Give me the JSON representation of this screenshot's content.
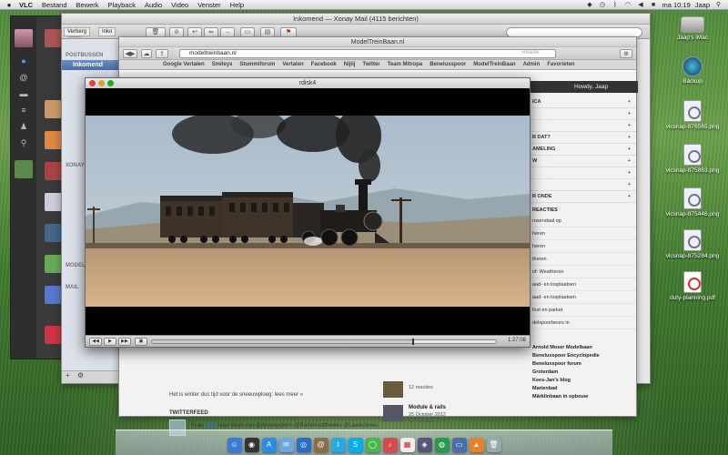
{
  "menubar": {
    "apple": "",
    "items": [
      "VLC",
      "Bestand",
      "Bewerk",
      "Playback",
      "Audio",
      "Video",
      "Venster",
      "Help"
    ],
    "clock": "ma 10:19",
    "user": "Jaap"
  },
  "mail": {
    "title": "Inkomend — Xonay Mail (4115 berichten)",
    "search_placeholder": "",
    "tab_hide": "Verberg",
    "tab_inbox": "Inko",
    "section_mailboxes": "POSTBUSSEN",
    "inbox": "Inkomend",
    "section_xonay": "XONAY",
    "section_model": "MODEL",
    "section_mail": "MAIL"
  },
  "browser": {
    "title": "ModelTreinBaan.nl",
    "url": "modeltreinbaan.nl",
    "reader": "Reader",
    "bookmarks": [
      "Google Vertalen",
      "Smileys",
      "Stummiforum",
      "Vertalen",
      "Facebook",
      "Nijlij",
      "Twitter",
      "Team Mitropa",
      "Beneluxspoor",
      "ModelTreinBaan",
      "Admin",
      "Favorieten"
    ],
    "howdy": "Howdy, Jaap",
    "right_rows": [
      "ICA",
      "",
      "",
      "R DAT?",
      "AMELING",
      "W",
      "",
      "",
      "R ONDE"
    ],
    "reacties_title": "REACTIES",
    "reacties": [
      "rosendaal op",
      "heren",
      "heren",
      "theren",
      "of: Weatheren",
      "aad- en losplaatsen",
      "aad- en losplaatsen",
      "fost en parket",
      "delspoorbeurs in"
    ],
    "links": [
      "Arnold Moser Modelbaan",
      "Beneluxspoor Encyclopedie",
      "Beneluxspoor forum",
      "Groterdam",
      "Kees-Jan's blog",
      "Marienbad",
      "Märklinbaan in opbouw"
    ],
    "posts": [
      {
        "title": "",
        "meta": "12 reacties"
      },
      {
        "title": "Module & rails",
        "meta": "25 October 2012"
      },
      {
        "title": "",
        "meta": "12 reacties"
      }
    ],
    "snow_text": "Het is winter dus tijd voor de sneeuwploeg: lees meer »",
    "twitter_hdr": "TWITTERFEED",
    "tweet_prefix": "In de",
    "tweet_link": "trein",
    "tweet_rest": "naar bivak met @dylanspijkers @Ramonsotthewes @LawieJones"
  },
  "vlc": {
    "title": "rdisk4",
    "time": "1:27:08",
    "progress": 0.76
  },
  "desktop_icons": [
    {
      "label": "Jaap's iMac",
      "kind": "hd"
    },
    {
      "label": "Backup",
      "kind": "tm"
    },
    {
      "label": "vlcsnap-876565.png",
      "kind": "png"
    },
    {
      "label": "vlcsnap-875863.png",
      "kind": "png"
    },
    {
      "label": "vlcsnap-875446.png",
      "kind": "png"
    },
    {
      "label": "vlcsnap-875284.png",
      "kind": "png"
    },
    {
      "label": "duty-planning.pdf",
      "kind": "pdf"
    }
  ],
  "dock_icons": [
    "finder-icon",
    "dashboard-icon",
    "app-store-icon",
    "mail-icon",
    "safari-icon",
    "contacts-icon",
    "twitter-icon",
    "skype-icon",
    "messages-icon",
    "music-icon",
    "calendar-icon",
    "photos-icon",
    "chrome-icon",
    "trash-icon"
  ],
  "colors": {
    "selection": "#4a6fa8",
    "grass": "#4f8a3a",
    "sky": "#b7c9d6"
  }
}
